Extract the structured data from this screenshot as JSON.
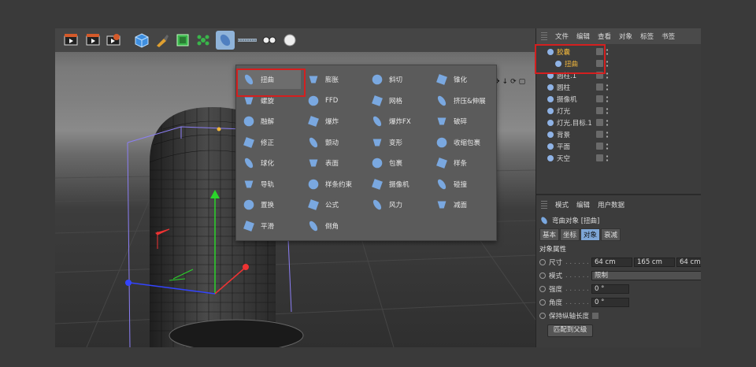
{
  "menu": {
    "columns": [
      [
        {
          "label": "扭曲",
          "icon": "bend-deformer-icon",
          "color": "#7aa8e0"
        },
        {
          "label": "螺旋",
          "icon": "twist-deformer-icon",
          "color": "#7aa8e0"
        },
        {
          "label": "融解",
          "icon": "melt-deformer-icon",
          "color": "#7aa8e0"
        },
        {
          "label": "修正",
          "icon": "correction-deformer-icon",
          "color": "#7aa8e0"
        },
        {
          "label": "球化",
          "icon": "spherify-deformer-icon",
          "color": "#7aa8e0"
        },
        {
          "label": "导轨",
          "icon": "rail-deformer-icon",
          "color": "#7aa8e0"
        },
        {
          "label": "置换",
          "icon": "displacer-deformer-icon",
          "color": "#7aa8e0"
        },
        {
          "label": "平滑",
          "icon": "smoothing-deformer-icon",
          "color": "#7aa8e0"
        }
      ],
      [
        {
          "label": "膨胀",
          "icon": "bulge-deformer-icon",
          "color": "#7aa8e0"
        },
        {
          "label": "FFD",
          "icon": "ffd-deformer-icon",
          "color": "#7aa8e0"
        },
        {
          "label": "爆炸",
          "icon": "explosion-deformer-icon",
          "color": "#7aa8e0"
        },
        {
          "label": "颤动",
          "icon": "jiggle-deformer-icon",
          "color": "#7aa8e0"
        },
        {
          "label": "表面",
          "icon": "surface-deformer-icon",
          "color": "#7aa8e0"
        },
        {
          "label": "样条约束",
          "icon": "spline-wrap-icon",
          "color": "#7aa8e0"
        },
        {
          "label": "公式",
          "icon": "formula-deformer-icon",
          "color": "#7aa8e0"
        },
        {
          "label": "倒角",
          "icon": "bevel-deformer-icon",
          "color": "#7aa8e0"
        }
      ],
      [
        {
          "label": "斜切",
          "icon": "shear-deformer-icon",
          "color": "#7aa8e0"
        },
        {
          "label": "网格",
          "icon": "mesh-deformer-icon",
          "color": "#7aa8e0"
        },
        {
          "label": "爆炸FX",
          "icon": "explosion-fx-icon",
          "color": "#7aa8e0"
        },
        {
          "label": "变形",
          "icon": "morph-deformer-icon",
          "color": "#7aa8e0"
        },
        {
          "label": "包裹",
          "icon": "wrap-deformer-icon",
          "color": "#7aa8e0"
        },
        {
          "label": "摄像机",
          "icon": "camera-deformer-icon",
          "color": "#7aa8e0"
        },
        {
          "label": "风力",
          "icon": "wind-deformer-icon",
          "color": "#7aa8e0"
        }
      ],
      [
        {
          "label": "锥化",
          "icon": "taper-deformer-icon",
          "color": "#7aa8e0"
        },
        {
          "label": "挤压&伸展",
          "icon": "squash-stretch-icon",
          "color": "#7aa8e0"
        },
        {
          "label": "破碎",
          "icon": "shatter-deformer-icon",
          "color": "#7aa8e0"
        },
        {
          "label": "收缩包裹",
          "icon": "shrink-wrap-icon",
          "color": "#7aa8e0"
        },
        {
          "label": "样条",
          "icon": "spline-deformer-icon",
          "color": "#7aa8e0"
        },
        {
          "label": "碰撞",
          "icon": "collision-deformer-icon",
          "color": "#7aa8e0"
        },
        {
          "label": "减面",
          "icon": "polygon-reduction-icon",
          "color": "#7aa8e0"
        }
      ]
    ]
  },
  "object_manager": {
    "menubar": [
      "文件",
      "编辑",
      "查看",
      "对象",
      "标签",
      "书签"
    ],
    "rows": [
      {
        "name": "胶囊",
        "indent": 0,
        "highlight": true
      },
      {
        "name": "扭曲",
        "indent": 1,
        "highlight": true
      },
      {
        "name": "圆柱.1",
        "indent": 0,
        "highlight": false
      },
      {
        "name": "圆柱",
        "indent": 0,
        "highlight": false
      },
      {
        "name": "摄像机",
        "indent": 0,
        "highlight": false
      },
      {
        "name": "灯光",
        "indent": 0,
        "highlight": false
      },
      {
        "name": "灯光.目标.1",
        "indent": 0,
        "highlight": false
      },
      {
        "name": "背景",
        "indent": 0,
        "highlight": false
      },
      {
        "name": "平面",
        "indent": 0,
        "highlight": false
      },
      {
        "name": "天空",
        "indent": 0,
        "highlight": false
      }
    ]
  },
  "attributes": {
    "menubar": [
      "模式",
      "编辑",
      "用户数据"
    ],
    "object_title": "弯曲对象 [扭曲]",
    "tabs": [
      "基本",
      "坐标",
      "对象",
      "衰减"
    ],
    "active_tab": "对象",
    "section": "对象属性",
    "fields": {
      "size_label": "尺寸",
      "size_x": "64 cm",
      "size_y": "165 cm",
      "size_z": "64 cm",
      "mode_label": "模式",
      "mode_value": "限制",
      "strength_label": "强度",
      "strength_value": "0 °",
      "angle_label": "角度",
      "angle_value": "0 °",
      "keep_length_label": "保持纵轴长度"
    },
    "match_button": "匹配到父级"
  },
  "colors": {
    "highlight_box": "#d41f1f",
    "selected_name": "#f0b63c",
    "active_tab": "#7ea6d6"
  }
}
